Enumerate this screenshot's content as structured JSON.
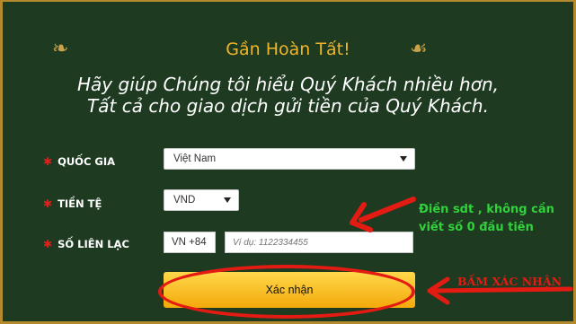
{
  "header": {
    "title": "Gần Hoàn Tất!",
    "subtitle_line1": "Hãy giúp Chúng tôi hiểu Quý Khách nhiều hơn,",
    "subtitle_line2": "Tất cả cho giao dịch gửi tiền của Quý Khách."
  },
  "form": {
    "country": {
      "label": "QUỐC GIA",
      "value": "Việt Nam"
    },
    "currency": {
      "label": "TIỀN TỆ",
      "value": "VND"
    },
    "contact": {
      "label": "SỐ LIÊN LẠC",
      "prefix": "VN +84",
      "placeholder": "Ví dụ: 1122334455"
    },
    "submit_label": "Xác nhận"
  },
  "annotations": {
    "phone_hint_line1": "Điền sdt , không cần",
    "phone_hint_line2": "viết số 0 đầu tiên",
    "confirm_hint": "BẤM XÁC NHẬN"
  },
  "colors": {
    "background": "#1e3b21",
    "title": "#f0b429",
    "annotation_green": "#30d13b",
    "annotation_red": "#e31b12",
    "button_gradient_top": "#ffd84a"
  },
  "icons": [
    "required-star-icon",
    "dropdown-caret-icon",
    "flourish-ornament-icon"
  ]
}
